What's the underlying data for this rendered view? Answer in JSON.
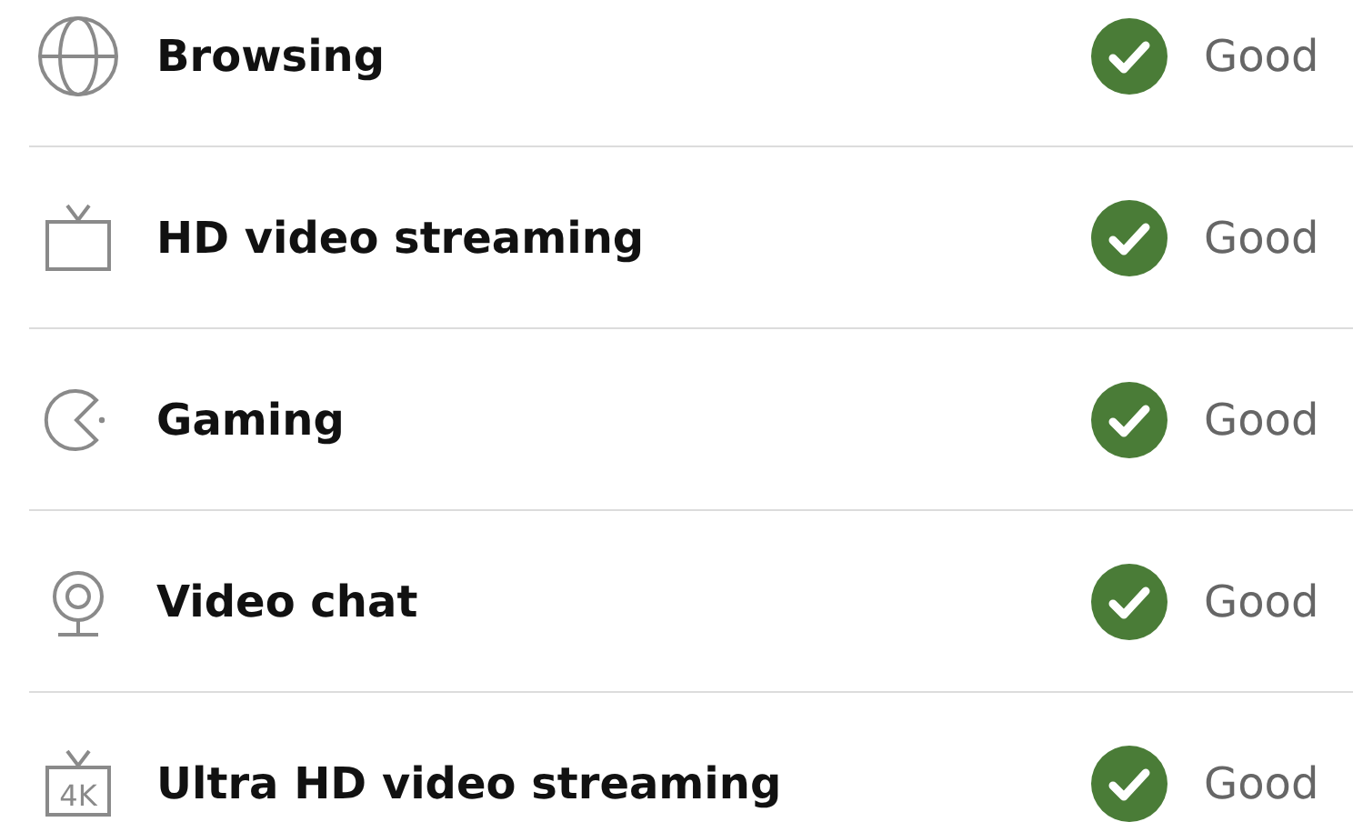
{
  "activities": [
    {
      "kind": "globe",
      "label": "Browsing",
      "status_ok": true,
      "status": "Good"
    },
    {
      "kind": "tv",
      "label": "HD video streaming",
      "status_ok": true,
      "status": "Good"
    },
    {
      "kind": "gamepad",
      "label": "Gaming",
      "status_ok": true,
      "status": "Good"
    },
    {
      "kind": "webcam",
      "label": "Video chat",
      "status_ok": true,
      "status": "Good"
    },
    {
      "kind": "tv4k",
      "label": "Ultra HD video streaming",
      "status_ok": true,
      "status": "Good",
      "icon_text": "4K"
    }
  ]
}
